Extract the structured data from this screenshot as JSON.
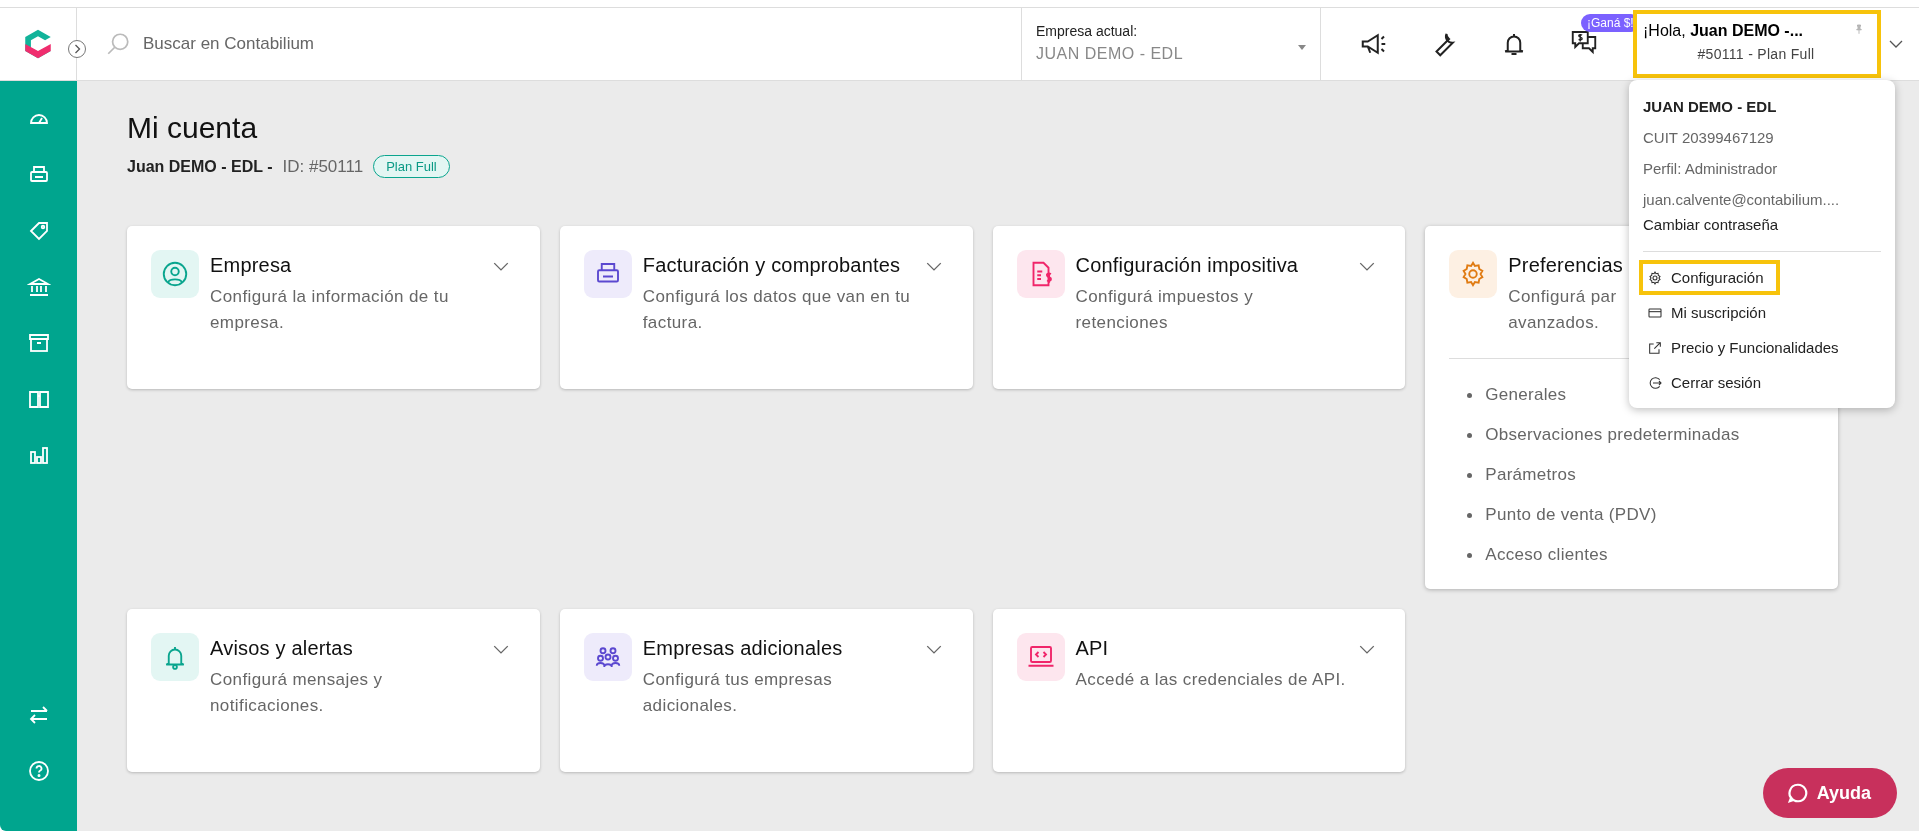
{
  "topbar": {
    "search": {
      "placeholder": "Buscar en Contabilium"
    },
    "company_select": {
      "label": "Empresa actual:",
      "value": "JUAN DEMO - EDL"
    },
    "promo_badge": "¡Ganá $!",
    "user_button": {
      "greeting": "¡Hola, **Juan DEMO -...**",
      "plan": "#50111 - Plan Full",
      "highlighted": true
    }
  },
  "page": {
    "title": "Mi cuenta",
    "account_name": "Juan DEMO - EDL -",
    "account_id": "ID: #50111",
    "plan_badge": "Plan Full"
  },
  "cards": [
    {
      "title": "Empresa",
      "description": "Configurá la información de tu empresa.",
      "color": "#0aa58e",
      "expanded": false
    },
    {
      "title": "Facturación y comprobantes",
      "description": "Configurá los datos que van en tu factura.",
      "color": "#5b48d0",
      "expanded": false
    },
    {
      "title": "Configuración impositiva",
      "description": "Configurá impuestos y retenciones",
      "color": "#f0266a",
      "expanded": false
    },
    {
      "title": "Preferencias",
      "description": "Configurá par\navanzados.",
      "color": "#e07b12",
      "expanded": true,
      "items": [
        "Generales",
        "Observaciones predeterminadas",
        "Parámetros",
        "Punto de venta (PDV)",
        "Acceso clientes"
      ]
    },
    {
      "title": "Avisos y alertas",
      "description": "Configurá mensajes y notificaciones.",
      "color": "#0aa58e",
      "expanded": false
    },
    {
      "title": "Empresas adicionales",
      "description": "Configurá tus empresas adicionales.",
      "color": "#5b48d0",
      "expanded": false
    },
    {
      "title": "API",
      "description": "Accedé a las credenciales de API.",
      "color": "#f0266a",
      "expanded": false
    }
  ],
  "user_menu": {
    "name": "JUAN DEMO - EDL",
    "cuit": "CUIT 20399467129",
    "profile": "Perfil: Administrador",
    "email": "juan.calvente@contabilium....",
    "change_password": "Cambiar contraseña",
    "items": [
      {
        "label": "Configuración",
        "highlighted": true
      },
      {
        "label": "Mi suscripción",
        "highlighted": false
      },
      {
        "label": "Precio y Funcionalidades",
        "highlighted": false
      },
      {
        "label": "Cerrar sesión",
        "highlighted": false
      }
    ]
  },
  "help_button": "Ayuda"
}
